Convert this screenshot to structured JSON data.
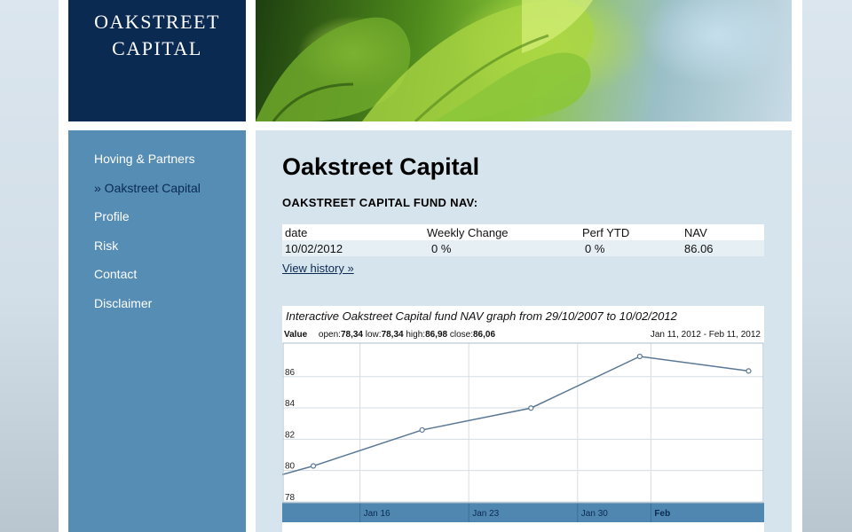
{
  "brand": {
    "line1": "OAKSTREET",
    "line2": "CAPITAL"
  },
  "nav": {
    "items": [
      {
        "label": "Hoving & Partners"
      },
      {
        "label": "» Oakstreet Capital"
      },
      {
        "label": "Profile"
      },
      {
        "label": "Risk"
      },
      {
        "label": "Contact"
      },
      {
        "label": "Disclaimer"
      }
    ]
  },
  "main": {
    "title": "Oakstreet Capital",
    "subtitle": "OAKSTREET CAPITAL FUND NAV:",
    "table": {
      "headers": [
        "date",
        "Weekly Change",
        "Perf YTD",
        "NAV"
      ],
      "row": [
        "10/02/2012",
        "0 %",
        "0 %",
        "86.06"
      ]
    },
    "history_link": "View history »"
  },
  "graph": {
    "caption": "Interactive Oakstreet Capital fund NAV graph from 29/10/2007 to 10/02/2012",
    "value_label": "Value",
    "open_label": "open:",
    "open": "78,34",
    "low_label": "low:",
    "low": "78,34",
    "high_label": "high:",
    "high": "86,98",
    "close_label": "close:",
    "close": "86,06",
    "range": "Jan 11, 2012 - Feb 11, 2012",
    "colors": {
      "line": "#5a7893",
      "bar": "#4f87b1",
      "grid": "#d5dde3"
    }
  },
  "chart_data": {
    "type": "line",
    "x": [
      "2012-01-11",
      "2012-01-13",
      "2012-01-20",
      "2012-01-27",
      "2012-02-03",
      "2012-02-10"
    ],
    "values": [
      79.4,
      79.95,
      82.25,
      83.65,
      86.95,
      86.02
    ],
    "x_range": [
      "2012-01-11",
      "2012-02-11"
    ],
    "ylim": [
      77.6,
      87.8
    ],
    "yticks": [
      78,
      80,
      82,
      84,
      86
    ],
    "xticks": [
      {
        "label": "Jan 16",
        "date": "2012-01-16"
      },
      {
        "label": "Jan 23",
        "date": "2012-01-23"
      },
      {
        "label": "Jan 30",
        "date": "2012-01-30"
      },
      {
        "label": "Feb",
        "date": "2012-02-06"
      }
    ],
    "grid": true
  }
}
